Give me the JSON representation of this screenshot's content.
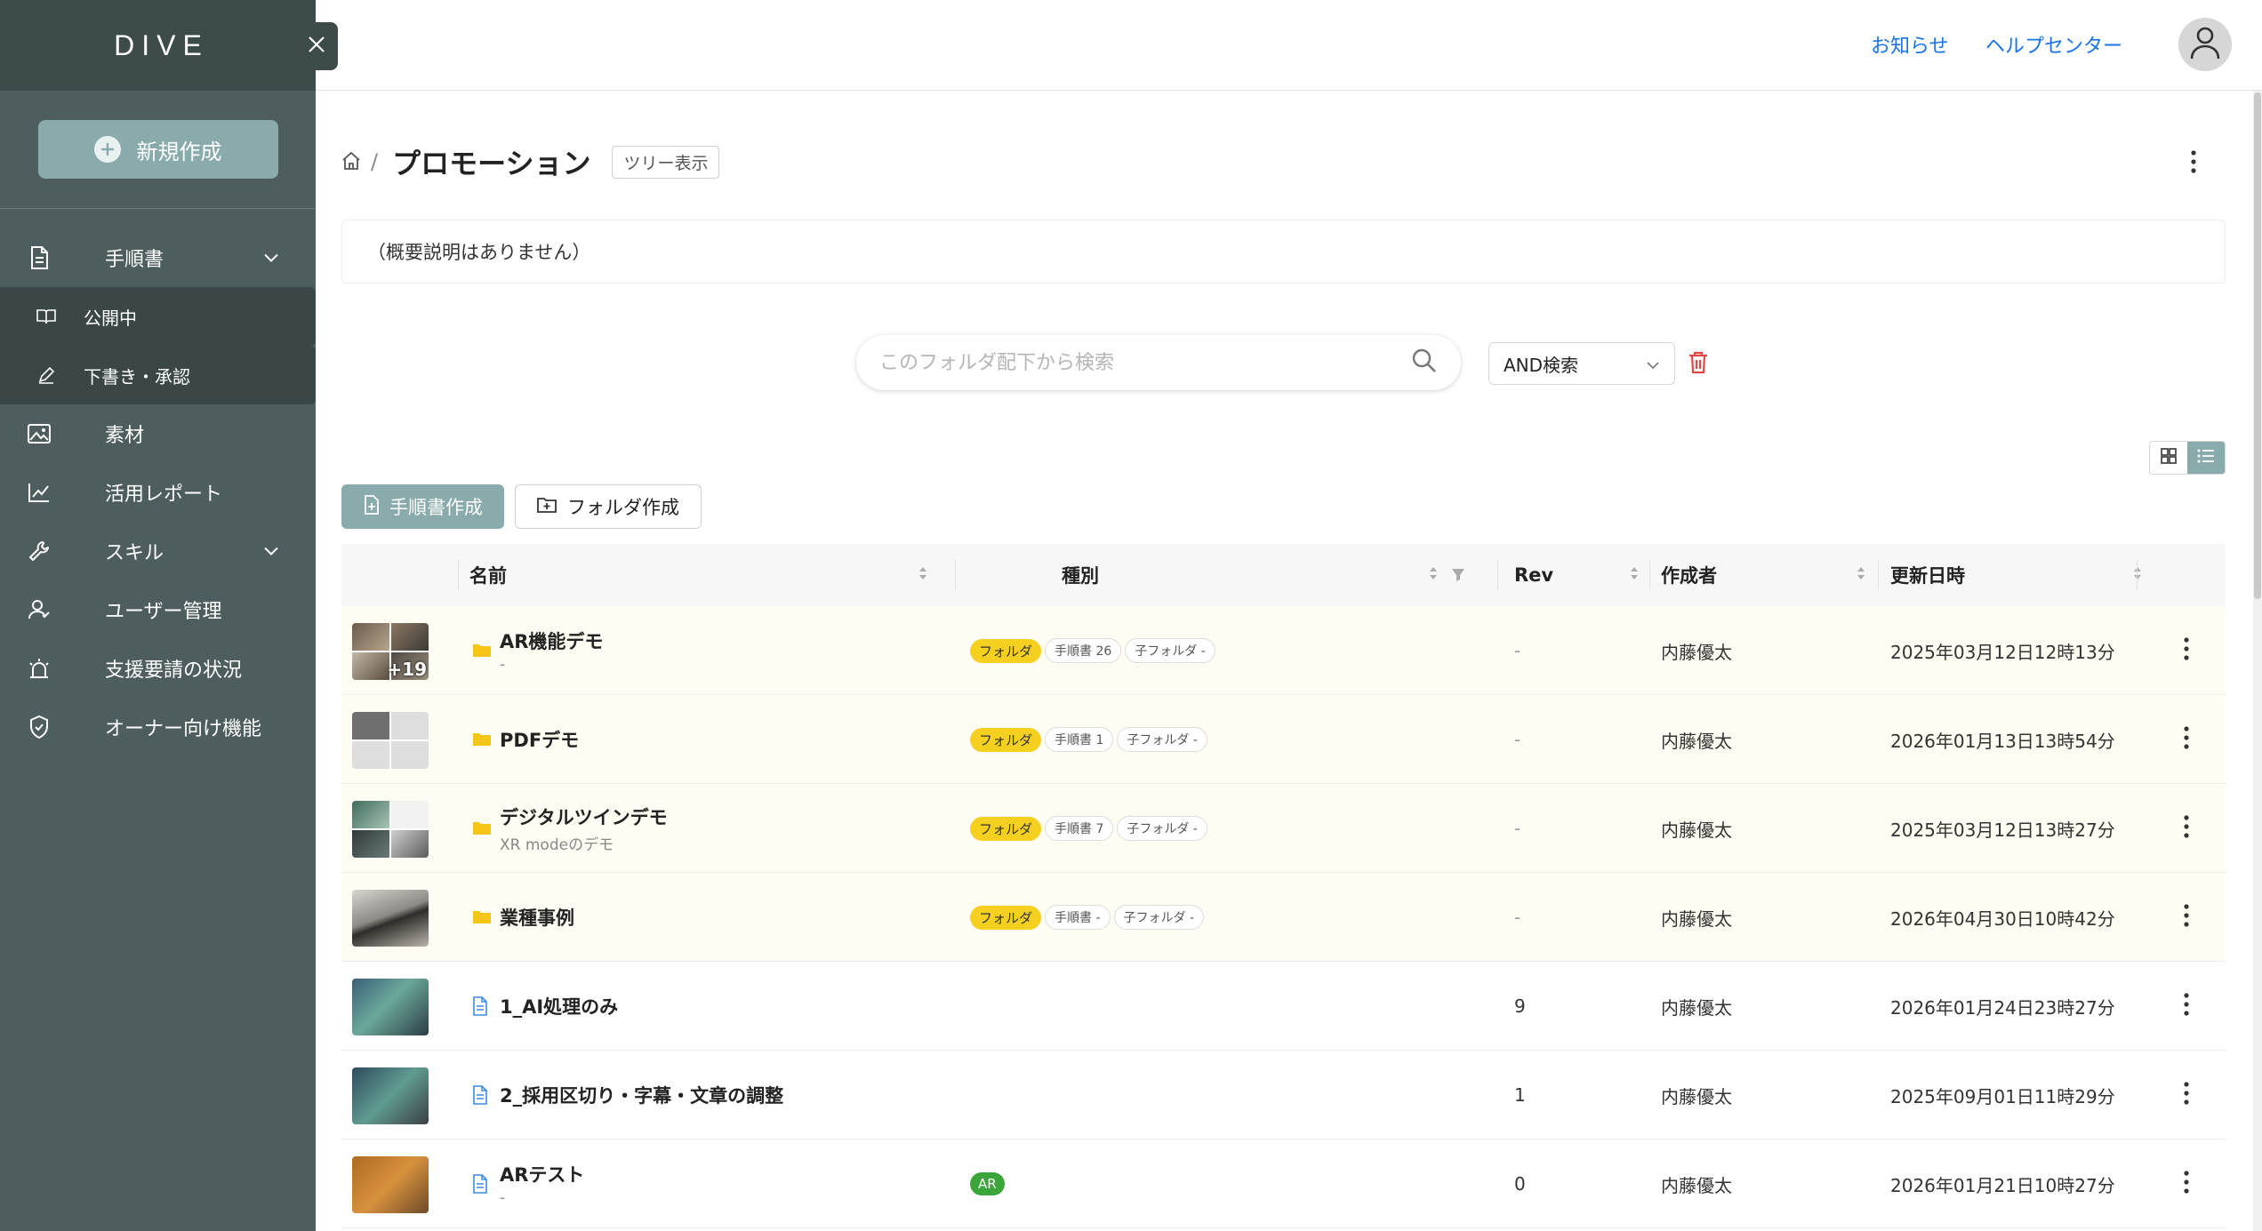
{
  "app": {
    "logo": "DIVE"
  },
  "sidebar": {
    "new_button": "新規作成",
    "items": [
      {
        "key": "manual",
        "label": "手順書"
      },
      {
        "key": "published",
        "label": "公開中"
      },
      {
        "key": "draft",
        "label": "下書き・承認"
      },
      {
        "key": "material",
        "label": "素材"
      },
      {
        "key": "report",
        "label": "活用レポート"
      },
      {
        "key": "skill",
        "label": "スキル"
      },
      {
        "key": "users",
        "label": "ユーザー管理"
      },
      {
        "key": "support",
        "label": "支援要請の状況"
      },
      {
        "key": "owner",
        "label": "オーナー向け機能"
      }
    ]
  },
  "header": {
    "news": "お知らせ",
    "help": "ヘルプセンター"
  },
  "page": {
    "separator": "/",
    "title": "プロモーション",
    "tree_button": "ツリー表示",
    "description": "（概要説明はありません）"
  },
  "search": {
    "placeholder": "このフォルダ配下から検索",
    "mode": "AND検索"
  },
  "actions": {
    "create_manual": "手順書作成",
    "create_folder": "フォルダ作成"
  },
  "table": {
    "headers": {
      "name": "名前",
      "type": "種別",
      "rev": "Rev",
      "author": "作成者",
      "updated": "更新日時"
    },
    "rows": [
      {
        "kind": "folder",
        "name": "AR機能デモ",
        "sub": "-",
        "badge": "フォルダ",
        "manual_count": "手順書 26",
        "subfolder": "子フォルダ -",
        "rev": "-",
        "author": "内藤優太",
        "updated": "2025年03月12日12時13分",
        "more": "+19"
      },
      {
        "kind": "folder",
        "name": "PDFデモ",
        "sub": "",
        "badge": "フォルダ",
        "manual_count": "手順書 1",
        "subfolder": "子フォルダ -",
        "rev": "-",
        "author": "内藤優太",
        "updated": "2026年01月13日13時54分"
      },
      {
        "kind": "folder",
        "name": "デジタルツインデモ",
        "sub": "XR modeのデモ",
        "badge": "フォルダ",
        "manual_count": "手順書 7",
        "subfolder": "子フォルダ -",
        "rev": "-",
        "author": "内藤優太",
        "updated": "2025年03月12日13時27分"
      },
      {
        "kind": "folder",
        "name": "業種事例",
        "sub": "",
        "badge": "フォルダ",
        "manual_count": "手順書 -",
        "subfolder": "子フォルダ -",
        "rev": "-",
        "author": "内藤優太",
        "updated": "2026年04月30日10時42分"
      },
      {
        "kind": "doc",
        "name": "1_AI処理のみ",
        "sub": "",
        "rev": "9",
        "author": "内藤優太",
        "updated": "2026年01月24日23時27分"
      },
      {
        "kind": "doc",
        "name": "2_採用区切り・字幕・文章の調整",
        "sub": "",
        "rev": "1",
        "author": "内藤優太",
        "updated": "2025年09月01日11時29分"
      },
      {
        "kind": "doc",
        "name": "ARテスト",
        "sub": "-",
        "badge": "AR",
        "rev": "0",
        "author": "内藤優太",
        "updated": "2026年01月21日10時27分"
      }
    ]
  },
  "colors": {
    "sidebar": "#4e5e5e",
    "accent": "#8aabab",
    "link": "#1a73e8",
    "folder_badge": "#f5d020",
    "ar_badge": "#3aa63a"
  }
}
